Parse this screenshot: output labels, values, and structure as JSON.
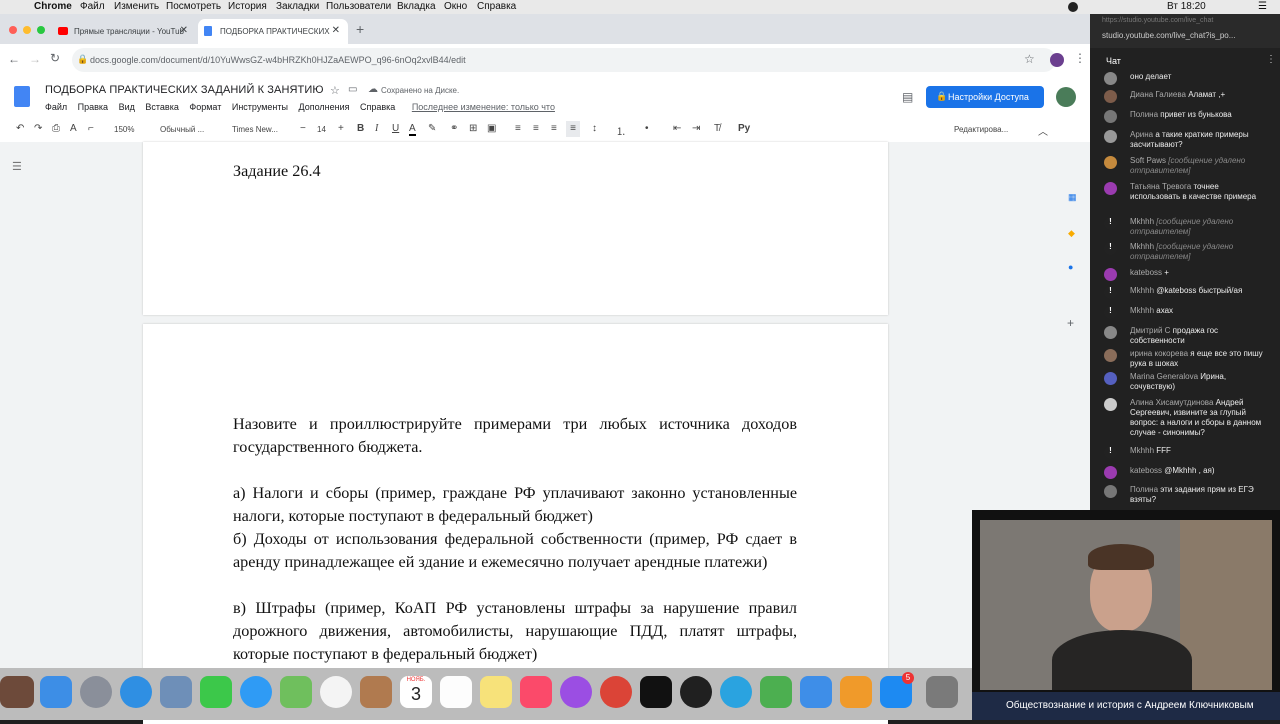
{
  "macbar": {
    "app": "Chrome",
    "menus": [
      "Файл",
      "Изменить",
      "Посмотреть",
      "История",
      "Закладки",
      "Пользователи",
      "Вкладка",
      "Окно",
      "Справка"
    ],
    "clock": "Вт 18:20"
  },
  "browser": {
    "tabs": [
      {
        "title": "Прямые трансляции - YouTube",
        "active": false
      },
      {
        "title": "ПОДБОРКА ПРАКТИЧЕСКИХ ЗАДАНИЙ",
        "active": true
      }
    ],
    "url": "docs.google.com/document/d/10YuWwsGZ-w4bHRZKh0HJZaAEWPO_q96-6nOq2xvlB44/edit"
  },
  "docs": {
    "title": "ПОДБОРКА ПРАКТИЧЕСКИХ ЗАДАНИЙ К ЗАНЯТИЮ",
    "saved": "Сохранено на Диске.",
    "menus": [
      "Файл",
      "Правка",
      "Вид",
      "Вставка",
      "Формат",
      "Инструменты",
      "Дополнения",
      "Справка"
    ],
    "last_edit": "Последнее изменение: только что",
    "share_label": "Настройки Доступа",
    "zoom": "150%",
    "style": "Обычный ...",
    "font": "Times New...",
    "font_size": "14",
    "edit_mode": "Редактирова..."
  },
  "page1": {
    "heading": "Задание 26.4"
  },
  "page2": {
    "question": "Назовите и проиллюстрируйте примерами три любых источника доходов государственного бюджета.",
    "a": "а) Налоги и сборы (пример, граждане РФ уплачивают законно установленные налоги, которые поступают в федеральный бюджет)",
    "b": "б) Доходы от использования федеральной собственности (пример, РФ сдает в аренду принадлежащее ей здание и ежемесячно получает арендные платежи)",
    "c": "в) Штрафы (пример, КоАП РФ установлены штрафы за нарушение правил дорожного движения, автомобилисты, нарушающие ПДД, платят штрафы, которые поступают в федеральный бюджет)"
  },
  "chat": {
    "url": "https://studio.youtube.com/live_chat",
    "url2": "studio.youtube.com/live_chat?is_po...",
    "header": "Чат",
    "messages": [
      {
        "author": "",
        "text": "оно делает",
        "deleted": false,
        "color": "#888"
      },
      {
        "author": "Диана Галиева",
        "text": "Аламат ,+",
        "deleted": false,
        "color": "#7d5c4a"
      },
      {
        "author": "Полина",
        "text": "привет из бунькова",
        "deleted": false,
        "color": "#777"
      },
      {
        "author": "Арина",
        "text": "а такие краткие примеры засчитывают?",
        "deleted": false,
        "color": "#999"
      },
      {
        "author": "Soft Paws",
        "text": "[сообщение удалено отправителем]",
        "deleted": true,
        "color": "#c58a3d"
      },
      {
        "author": "Татьяна Тревога",
        "text": "точнее использовать в качестве примера",
        "deleted": false,
        "color": "#9b3bb0"
      },
      {
        "author": "Mkhhh",
        "text": "[сообщение удалено отправителем]",
        "deleted": true,
        "color": "#222"
      },
      {
        "author": "Mkhhh",
        "text": "[сообщение удалено отправителем]",
        "deleted": true,
        "color": "#222"
      },
      {
        "author": "kateboss",
        "text": "+",
        "deleted": false,
        "color": "#9b3bb0"
      },
      {
        "author": "Mkhhh",
        "text": "@kateboss быстрый/ая",
        "deleted": false,
        "color": "#222"
      },
      {
        "author": "Mkhhh",
        "text": "ахах",
        "deleted": false,
        "color": "#222"
      },
      {
        "author": "Дмитрий С",
        "text": "продажа гос собственности",
        "deleted": false,
        "color": "#888"
      },
      {
        "author": "ирина кокорева",
        "text": "я еще все это пишу рука в шоках",
        "deleted": false,
        "color": "#8a6d5a"
      },
      {
        "author": "Marina Generalova",
        "text": "Ирина, сочувствую)",
        "deleted": false,
        "color": "#5560c0"
      },
      {
        "author": "Алина Хисамутдинова",
        "text": "Андрей Сергеевич, извините за глупый вопрос: а налоги и сборы в данном случае - синонимы?",
        "deleted": false,
        "color": "#ccc"
      },
      {
        "author": "Mkhhh",
        "text": "FFF",
        "deleted": false,
        "color": "#222"
      },
      {
        "author": "kateboss",
        "text": "@Mkhhh , ая)",
        "deleted": false,
        "color": "#9b3bb0"
      },
      {
        "author": "Полина",
        "text": "эти задания прям из ЕГЭ взяты?",
        "deleted": false,
        "color": "#777"
      }
    ]
  },
  "dock": {
    "calendar_month": "НОЯБ.",
    "calendar_day": "3",
    "badge": "5"
  },
  "webcam": {
    "caption": "Обществознание и история с Андреем Ключниковым"
  }
}
